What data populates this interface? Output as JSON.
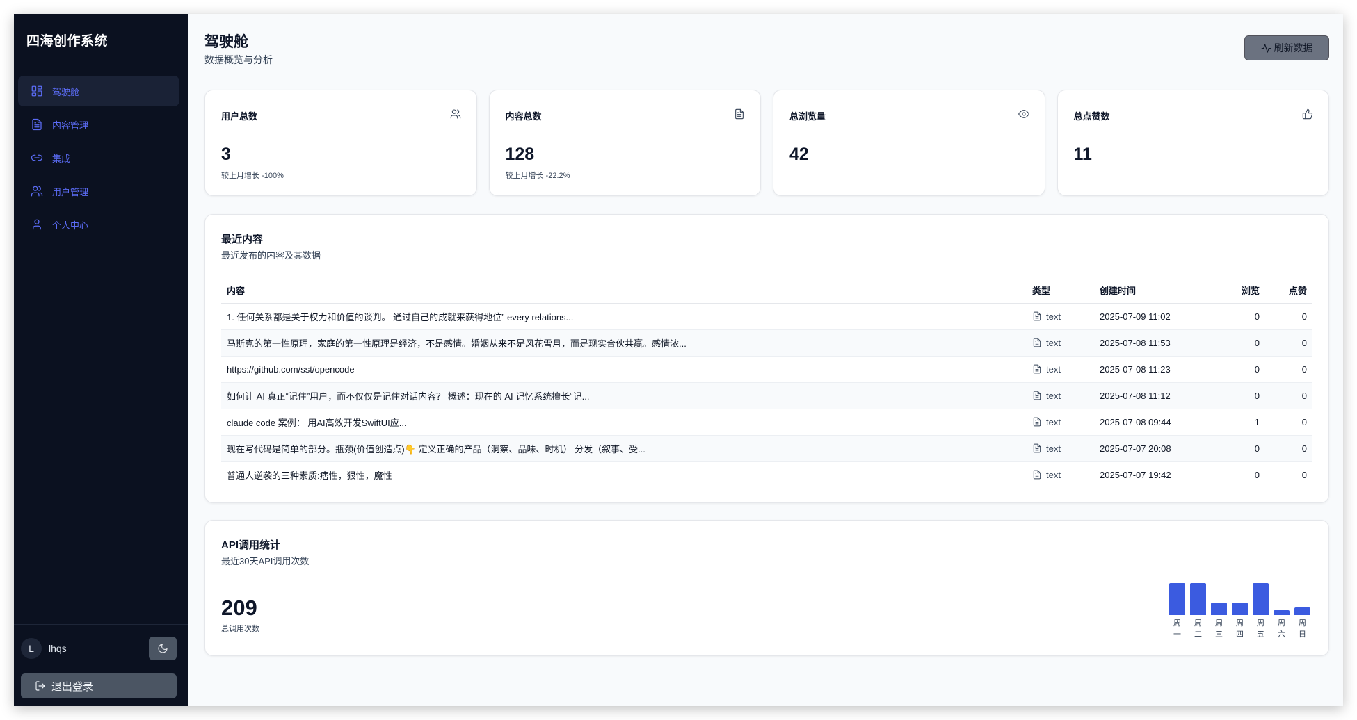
{
  "app": {
    "title": "四海创作系统"
  },
  "sidebar": {
    "items": [
      {
        "label": "驾驶舱",
        "icon": "dashboard-icon",
        "active": true
      },
      {
        "label": "内容管理",
        "icon": "document-icon",
        "active": false
      },
      {
        "label": "集成",
        "icon": "link-icon",
        "active": false
      },
      {
        "label": "用户管理",
        "icon": "users-icon",
        "active": false
      },
      {
        "label": "个人中心",
        "icon": "user-icon",
        "active": false
      }
    ],
    "user": {
      "avatar_letter": "L",
      "name": "lhqs"
    },
    "logout_label": "退出登录"
  },
  "header": {
    "title": "驾驶舱",
    "subtitle": "数据概览与分析",
    "refresh_label": "刷新数据"
  },
  "stats": [
    {
      "label": "用户总数",
      "value": "3",
      "note": "较上月增长 -100%",
      "icon": "users-icon"
    },
    {
      "label": "内容总数",
      "value": "128",
      "note": "较上月增长 -22.2%",
      "icon": "document-icon"
    },
    {
      "label": "总浏览量",
      "value": "42",
      "note": "",
      "icon": "eye-icon"
    },
    {
      "label": "总点赞数",
      "value": "11",
      "note": "",
      "icon": "thumbs-up-icon"
    }
  ],
  "recent": {
    "title": "最近内容",
    "description": "最近发布的内容及其数据",
    "columns": [
      "内容",
      "类型",
      "创建时间",
      "浏览",
      "点赞"
    ],
    "rows": [
      {
        "content": "1. 任何关系都是关于权力和价值的谈判。 通过自己的成就来获得地位” every relations...",
        "type": "text",
        "created": "2025-07-09 11:02",
        "views": "0",
        "likes": "0"
      },
      {
        "content": "马斯克的第一性原理，家庭的第一性原理是经济，不是感情。婚姻从来不是风花雪月，而是现实合伙共赢。感情浓...",
        "type": "text",
        "created": "2025-07-08 11:53",
        "views": "0",
        "likes": "0"
      },
      {
        "content": "https://github.com/sst/opencode",
        "type": "text",
        "created": "2025-07-08 11:23",
        "views": "0",
        "likes": "0"
      },
      {
        "content": "如何让 AI 真正“记住”用户，而不仅仅是记住对话内容？ 概述：现在的 AI 记忆系统擅长“记...",
        "type": "text",
        "created": "2025-07-08 11:12",
        "views": "0",
        "likes": "0"
      },
      {
        "content": "claude code 案例： 用AI高效开发SwiftUI应...",
        "type": "text",
        "created": "2025-07-08 09:44",
        "views": "1",
        "likes": "0"
      },
      {
        "content": "现在写代码是简单的部分。瓶颈(价值创造点)👇 定义正确的产品（洞察、品味、时机） 分发（叙事、受...",
        "type": "text",
        "created": "2025-07-07 20:08",
        "views": "0",
        "likes": "0"
      },
      {
        "content": "普通人逆袭的三种素质:痞性，狠性，魔性",
        "type": "text",
        "created": "2025-07-07 19:42",
        "views": "0",
        "likes": "0"
      }
    ]
  },
  "api": {
    "title": "API调用统计",
    "description": "最近30天API调用次数",
    "total": "209",
    "total_label": "总调用次数"
  },
  "chart_data": {
    "type": "bar",
    "categories": [
      "周一",
      "周二",
      "周三",
      "周四",
      "周五",
      "周六",
      "周日"
    ],
    "values": [
      48,
      48,
      19,
      19,
      48,
      7,
      12
    ],
    "color": "#3b5be0"
  },
  "colors": {
    "sidebar_bg": "#0b1120",
    "accent": "#5b6cf5",
    "bar": "#3b5be0"
  }
}
